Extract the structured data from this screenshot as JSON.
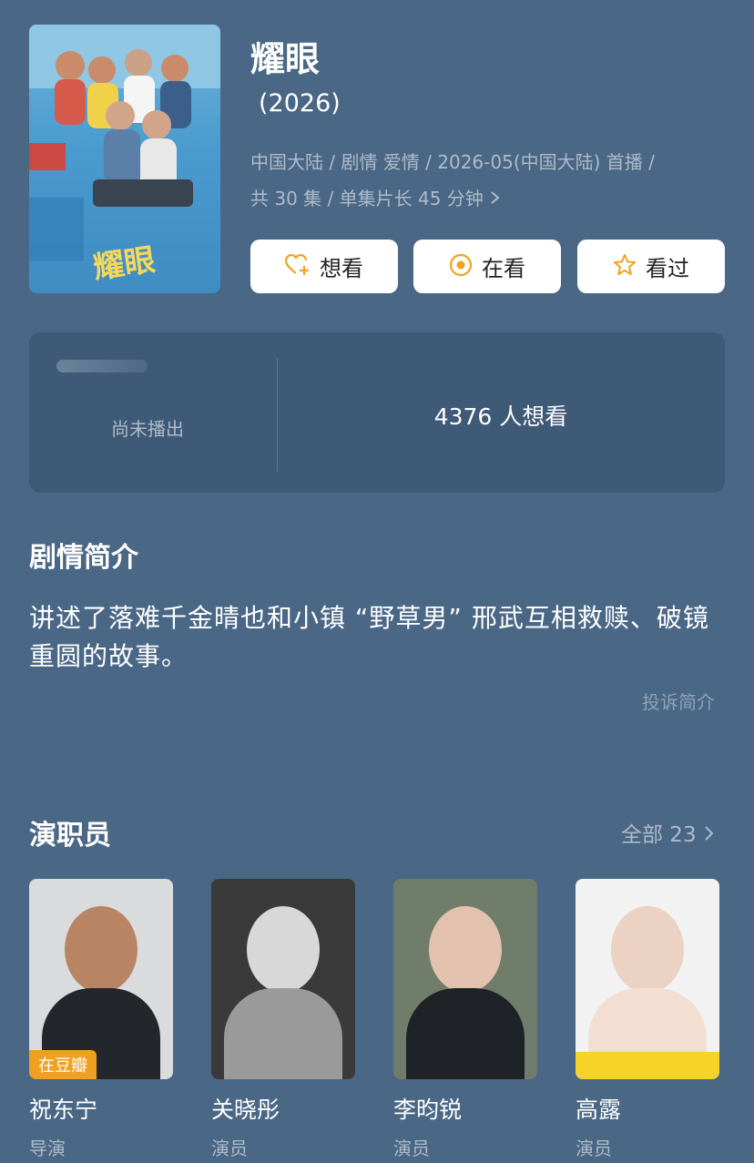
{
  "show": {
    "title": "耀眼",
    "year": "(2026)",
    "meta_line1": "中国大陆 / 剧情 爱情 / 2026-05(中国大陆) 首播 /",
    "meta_line2": "共 30 集 / 单集片长 45 分钟"
  },
  "poster": {
    "title_art": "耀眼"
  },
  "actions": [
    {
      "label": "想看",
      "icon": "heart-plus-icon"
    },
    {
      "label": "在看",
      "icon": "target-icon"
    },
    {
      "label": "看过",
      "icon": "star-icon"
    }
  ],
  "stats": {
    "status": "尚未播出",
    "wish_count": "4376 人想看"
  },
  "synopsis": {
    "heading": "剧情简介",
    "text": "讲述了落难千金晴也和小镇 “野草男” 邢武互相救赎、破镜重圆的故事。",
    "report_link": "投诉简介"
  },
  "cast": {
    "heading": "演职员",
    "all_link": "全部 23",
    "members": [
      {
        "name": "祝东宁",
        "role": "导演",
        "badge": "在豆瓣"
      },
      {
        "name": "关晓彤",
        "role": "演员"
      },
      {
        "name": "李昀锐",
        "role": "演员"
      },
      {
        "name": "高露",
        "role": "演员"
      }
    ]
  },
  "colors": {
    "background": "#4a6786",
    "card": "#3f5a76",
    "accent": "#f3a21b",
    "muted_text": "#aebbc9"
  }
}
